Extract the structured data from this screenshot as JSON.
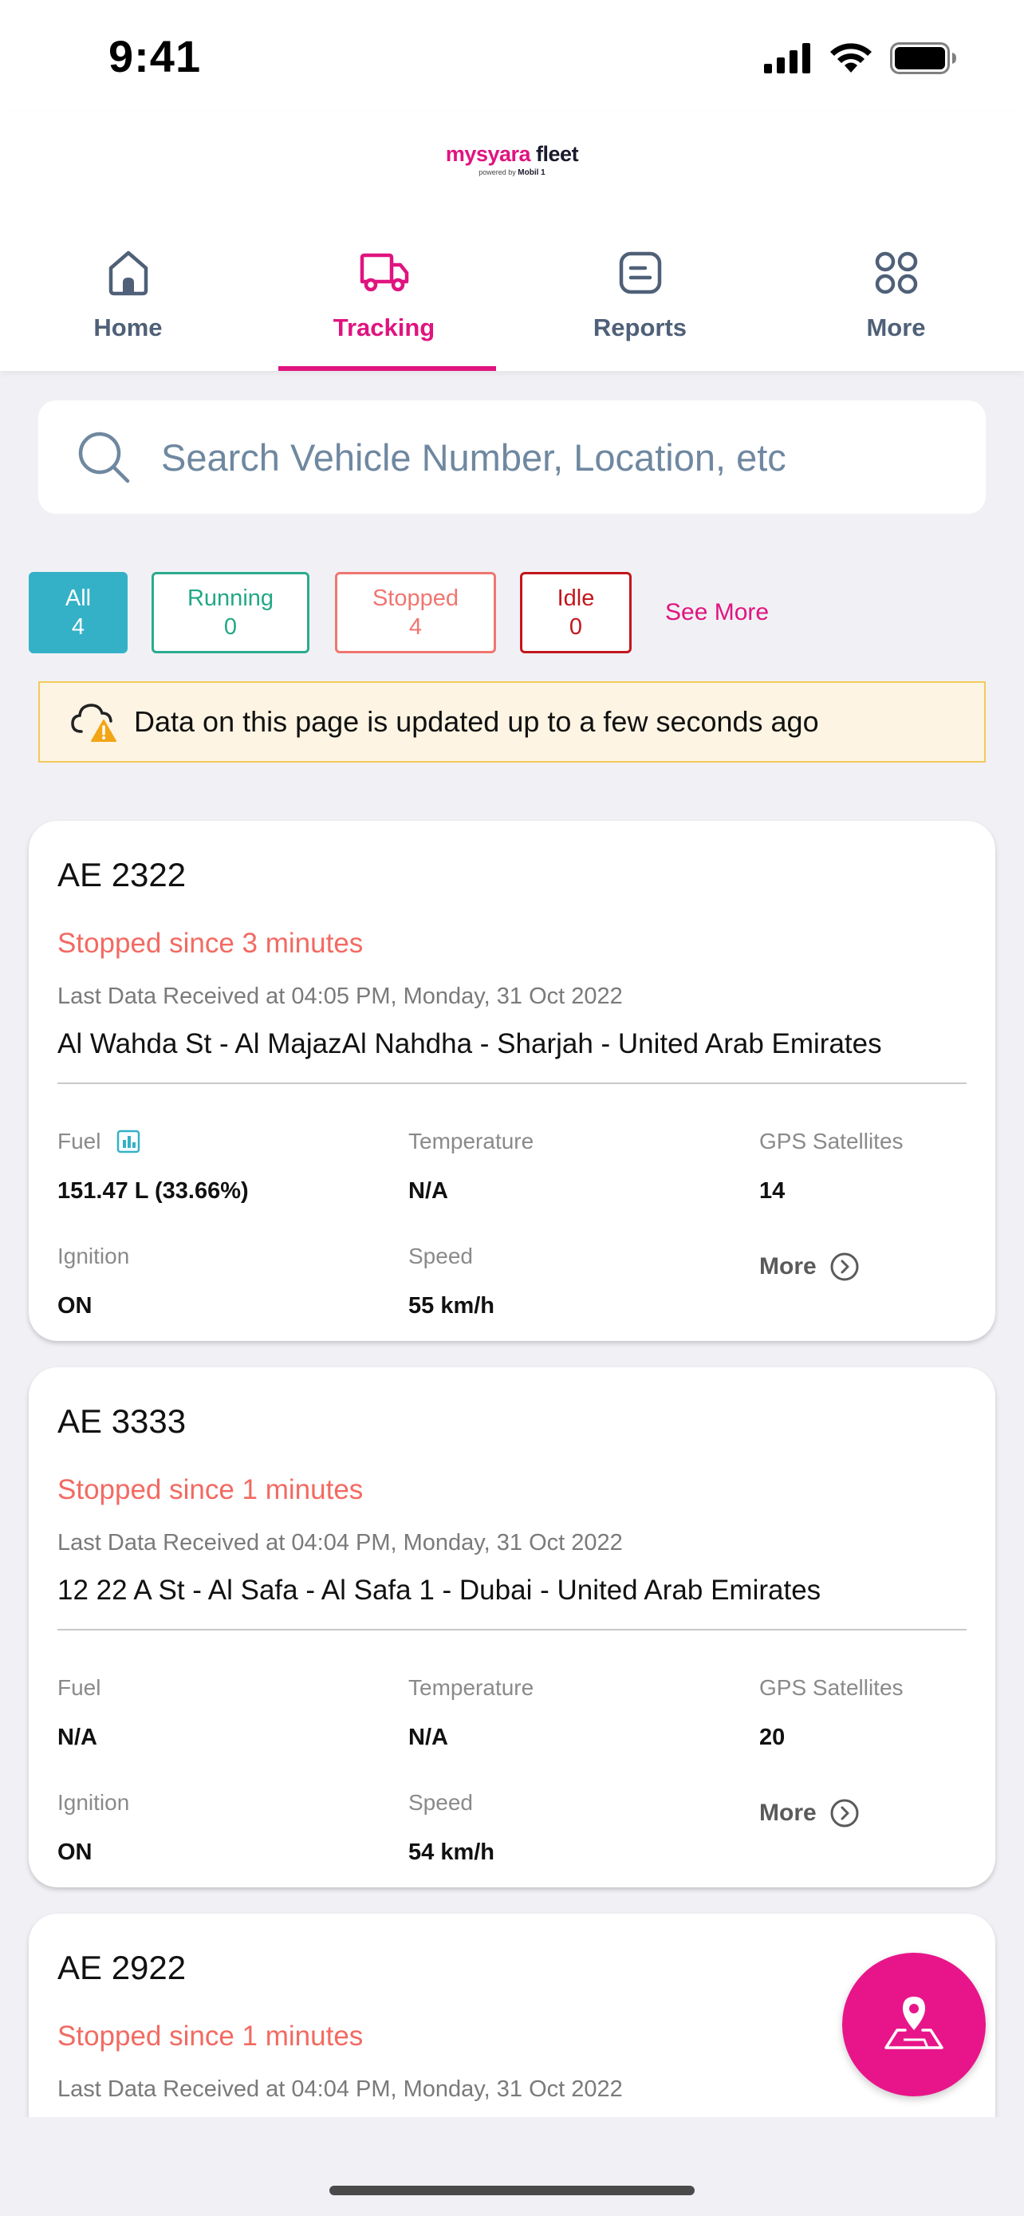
{
  "status_bar": {
    "time": "9:41"
  },
  "header": {
    "brand_a": "mysyara",
    "brand_b": "fleet",
    "powered_by": "powered by",
    "powered_brand": "Mobil 1"
  },
  "tabs": [
    {
      "label": "Home",
      "icon": "home-icon",
      "active": false
    },
    {
      "label": "Tracking",
      "icon": "truck-icon",
      "active": true
    },
    {
      "label": "Reports",
      "icon": "report-icon",
      "active": false
    },
    {
      "label": "More",
      "icon": "grid-icon",
      "active": false
    }
  ],
  "search": {
    "placeholder": "Search Vehicle Number, Location, etc"
  },
  "filters": {
    "all": {
      "label": "All",
      "count": "4"
    },
    "running": {
      "label": "Running",
      "count": "0"
    },
    "stopped": {
      "label": "Stopped",
      "count": "4"
    },
    "idle": {
      "label": "Idle",
      "count": "0"
    },
    "see_more": "See More"
  },
  "notice": {
    "text": "Data on this page is updated up to a few seconds ago"
  },
  "labels": {
    "fuel": "Fuel",
    "temperature": "Temperature",
    "gps": "GPS Satellites",
    "ignition": "Ignition",
    "speed": "Speed",
    "more": "More"
  },
  "vehicles": [
    {
      "plate": "AE 2322",
      "status": "Stopped since 3 minutes",
      "last_data": "Last Data Received at 04:05 PM, Monday, 31 Oct 2022",
      "address": "Al Wahda St - Al MajazAl Nahdha - Sharjah - United Arab Emirates",
      "fuel": "151.47 L  (33.66%)",
      "temperature": "N/A",
      "gps": "14",
      "ignition": "ON",
      "speed": "55 km/h"
    },
    {
      "plate": "AE 3333",
      "status": "Stopped since 1 minutes",
      "last_data": "Last Data Received at 04:04 PM, Monday, 31 Oct 2022",
      "address": "12 22 A St - Al Safa - Al Safa 1 - Dubai - United Arab Emirates",
      "fuel": "N/A",
      "temperature": "N/A",
      "gps": "20",
      "ignition": "ON",
      "speed": "54 km/h"
    },
    {
      "plate": "AE 2922",
      "status": "Stopped since 1 minutes",
      "last_data": "Last Data Received at 04:04 PM, Monday, 31 Oct 2022"
    }
  ],
  "colors": {
    "accent": "#e0147f",
    "all_chip": "#34b1c7",
    "running": "#22a886",
    "stopped": "#f07670",
    "idle": "#c3161c",
    "notice_bg": "#fdf4e3"
  }
}
